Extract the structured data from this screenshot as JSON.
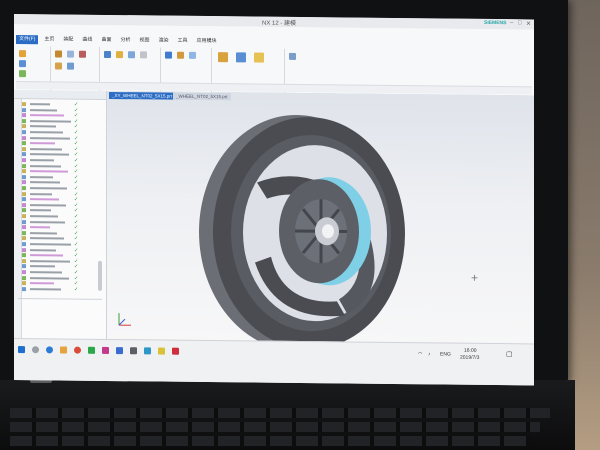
{
  "window": {
    "title": "NX 12 - 建模",
    "controls": [
      "–",
      "□",
      "✕"
    ],
    "brand": "SIEMENS"
  },
  "ribbon": {
    "tabs": [
      "文件(F)",
      "主页",
      "装配",
      "曲线",
      "曲面",
      "分析",
      "视图",
      "渲染",
      "工具",
      "应用模块"
    ],
    "active_tab": 0
  },
  "document_tabs": [
    "_XY_WHEEL_NT02_5X15.prt",
    "_WHEEL_NT02_5X15.prt"
  ],
  "taskbar": {
    "language": "ENG",
    "time": "16:00",
    "date": "2019/7/3"
  },
  "colors": {
    "accent": "#2b6cc4",
    "check": "#2f9a3a",
    "wheel": "#4a4c52",
    "hub_highlight": "#7fd0e6"
  },
  "icons": [
    "search-icon",
    "windows-icon",
    "gear-icon",
    "notification-icon",
    "wifi-icon",
    "volume-icon",
    "crosshair-icon"
  ]
}
